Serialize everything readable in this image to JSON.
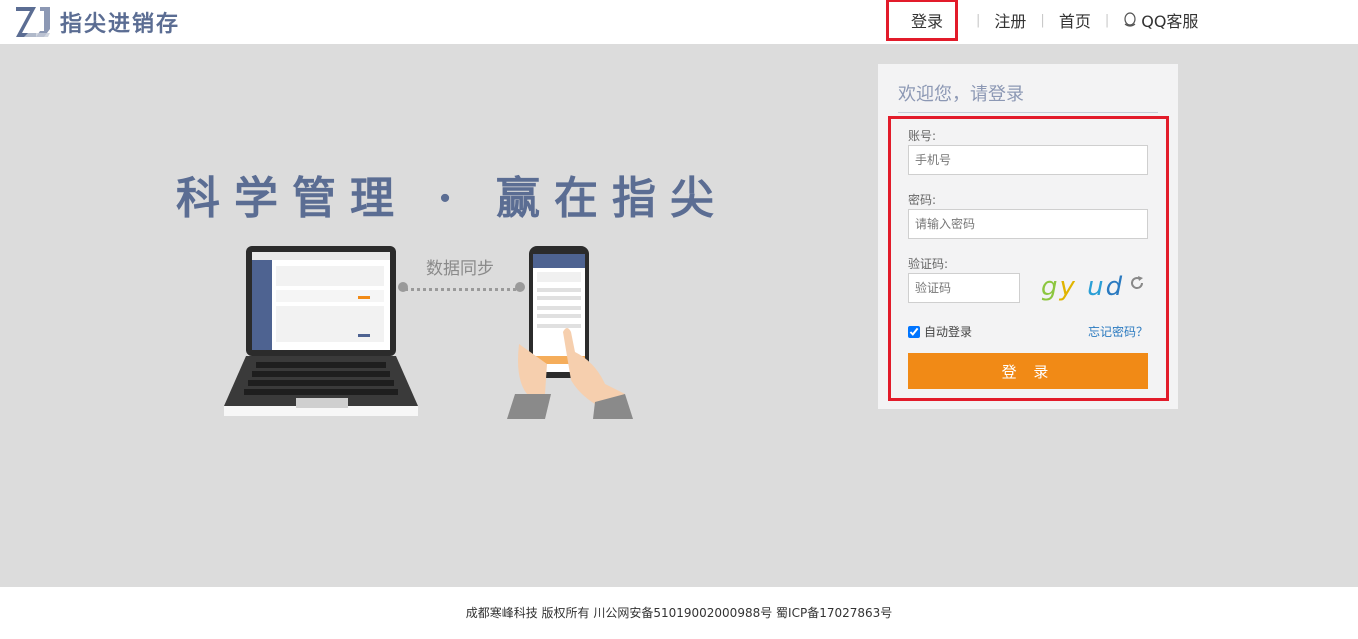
{
  "brand": {
    "name": "指尖进销存",
    "mark": "ZJ"
  },
  "nav": {
    "login": "登录",
    "register": "注册",
    "home": "首页",
    "qq_service": "QQ客服",
    "separator": "|"
  },
  "hero": {
    "slogan": "科学管理 · 赢在指尖",
    "sync_label": "数据同步"
  },
  "login_form": {
    "welcome": "欢迎您，请登录",
    "account_label": "账号:",
    "account_placeholder": "手机号",
    "password_label": "密码:",
    "password_placeholder": "请输入密码",
    "captcha_label": "验证码:",
    "captcha_placeholder": "验证码",
    "captcha_text": "gy ud",
    "auto_login": "自动登录",
    "auto_login_checked": true,
    "forgot_password": "忘记密码？",
    "submit": "登 录"
  },
  "footer": {
    "text": "成都寒峰科技 版权所有  川公网安备51019002000988号 蜀ICP备17027863号"
  },
  "colors": {
    "brand_blue": "#5b6d93",
    "hero_bg": "#dcdcdc",
    "submit_orange": "#f18a16",
    "highlight_red": "#e21b2a",
    "link_blue": "#2a7ac0"
  }
}
